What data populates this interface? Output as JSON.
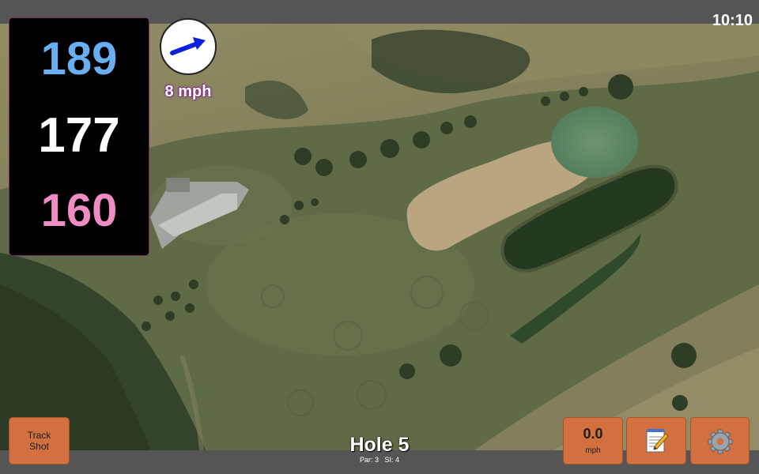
{
  "status_bar": {
    "time": "10:10"
  },
  "distances": {
    "back": "189",
    "middle": "177",
    "front": "160",
    "colors": {
      "back": "#6aaef2",
      "middle": "#ffffff",
      "front": "#f08cc4"
    }
  },
  "wind": {
    "speed_label": "8 mph",
    "icon": "wind-direction-arrow-icon",
    "arrow_color": "#0a1fe0"
  },
  "track_shot": {
    "label": "Track Shot"
  },
  "hole": {
    "title": "Hole 5",
    "par_label": "Par:",
    "par": "3",
    "si_label": "SI:",
    "si": "4"
  },
  "speed": {
    "value": "0.0",
    "unit": "mph"
  },
  "toolbar": {
    "notes_icon": "notepad-pencil-icon",
    "settings_icon": "gear-icon",
    "button_color": "#d2703f"
  },
  "map": {
    "type": "satellite"
  }
}
